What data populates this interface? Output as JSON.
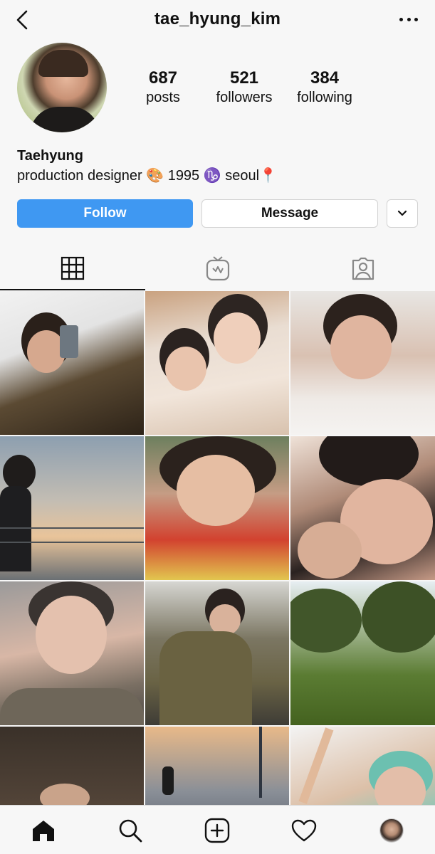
{
  "header": {
    "username": "tae_hyung_kim"
  },
  "profile": {
    "stats": {
      "posts_count": "687",
      "posts_label": "posts",
      "followers_count": "521",
      "followers_label": "followers",
      "following_count": "384",
      "following_label": "following"
    },
    "name": "Taehyung",
    "bio": "production designer 🎨  1995 ♑  seoul📍"
  },
  "actions": {
    "follow_label": "Follow",
    "message_label": "Message"
  },
  "tabs": [
    {
      "icon": "grid-icon",
      "active": true
    },
    {
      "icon": "igtv-icon",
      "active": false
    },
    {
      "icon": "tagged-icon",
      "active": false
    }
  ],
  "grid": {
    "count": 15
  },
  "bottom_nav": [
    {
      "icon": "home-icon"
    },
    {
      "icon": "search-icon"
    },
    {
      "icon": "new-post-icon"
    },
    {
      "icon": "activity-heart-icon"
    },
    {
      "icon": "profile-avatar"
    }
  ],
  "colors": {
    "follow_button": "#3f98f2",
    "background": "#f7f7f7",
    "text": "#111111"
  }
}
